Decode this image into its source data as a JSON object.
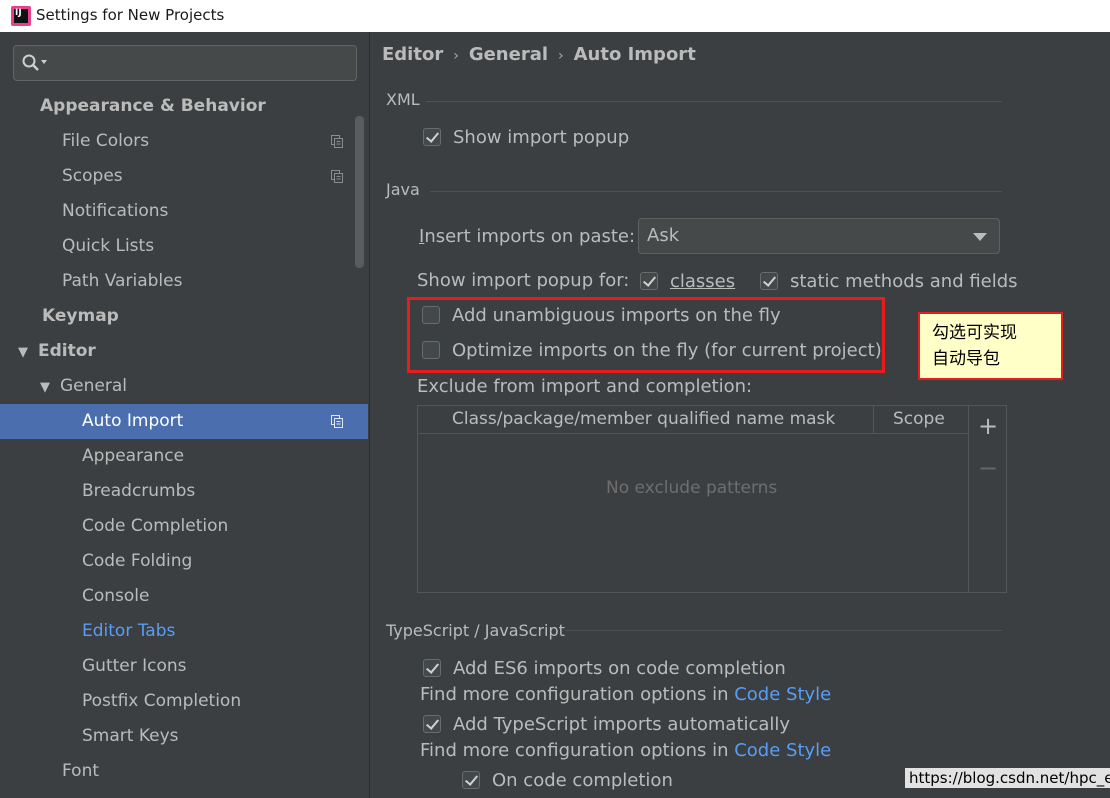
{
  "window": {
    "title": "Settings for New Projects"
  },
  "search": {
    "placeholder": ""
  },
  "tree": [
    {
      "label": "Appearance & Behavior",
      "level": 0,
      "bold": true
    },
    {
      "label": "File Colors",
      "level": 1,
      "copy_icon": true
    },
    {
      "label": "Scopes",
      "level": 1,
      "copy_icon": true
    },
    {
      "label": "Notifications",
      "level": 1
    },
    {
      "label": "Quick Lists",
      "level": 1
    },
    {
      "label": "Path Variables",
      "level": 1
    },
    {
      "label": "Keymap",
      "level": 0,
      "bold": true
    },
    {
      "label": "Editor",
      "level": 0,
      "bold": true,
      "expanded": true
    },
    {
      "label": "General",
      "level": 1,
      "expanded": true
    },
    {
      "label": "Auto Import",
      "level": 2,
      "selected": true,
      "copy_icon": true
    },
    {
      "label": "Appearance",
      "level": 2
    },
    {
      "label": "Breadcrumbs",
      "level": 2
    },
    {
      "label": "Code Completion",
      "level": 2
    },
    {
      "label": "Code Folding",
      "level": 2
    },
    {
      "label": "Console",
      "level": 2
    },
    {
      "label": "Editor Tabs",
      "level": 2,
      "link": true
    },
    {
      "label": "Gutter Icons",
      "level": 2
    },
    {
      "label": "Postfix Completion",
      "level": 2
    },
    {
      "label": "Smart Keys",
      "level": 2
    },
    {
      "label": "Font",
      "level": 1
    }
  ],
  "breadcrumb": [
    "Editor",
    "General",
    "Auto Import"
  ],
  "xml": {
    "title": "XML",
    "show_import_popup": {
      "label": "Show import popup",
      "checked": true
    }
  },
  "java": {
    "title": "Java",
    "insert_imports_label": "Insert imports on paste:",
    "insert_imports_value": "Ask",
    "show_popup_for_label": "Show import popup for:",
    "classes": {
      "label": "classes",
      "checked": true
    },
    "static_methods": {
      "label": "static methods and fields",
      "checked": true
    },
    "add_unambiguous": {
      "label": "Add unambiguous imports on the fly",
      "checked": false
    },
    "optimize_imports": {
      "label": "Optimize imports on the fly (for current project)",
      "checked": false
    },
    "exclude_label": "Exclude from import and completion:",
    "table_headers": [
      "Class/package/member qualified name mask",
      "Scope"
    ],
    "table_empty": "No exclude patterns",
    "add_btn": "+",
    "remove_btn": "−"
  },
  "annotation": {
    "line1": "勾选可实现",
    "line2": "自动导包"
  },
  "typescript": {
    "title": "TypeScript / JavaScript",
    "add_es6": {
      "label": "Add ES6 imports on code completion",
      "checked": true
    },
    "hint_prefix": "Find more configuration options in ",
    "hint_link": "Code Style",
    "add_ts": {
      "label": "Add TypeScript imports automatically",
      "checked": true
    },
    "on_completion": {
      "label": "On code completion",
      "checked": true
    }
  },
  "watermark": "https://blog.csdn.net/hpc_er",
  "colors": {
    "selection": "#4b6eaf",
    "link": "#589df6",
    "highlight": "#e41e1e",
    "callout_bg": "#ffffc8"
  }
}
